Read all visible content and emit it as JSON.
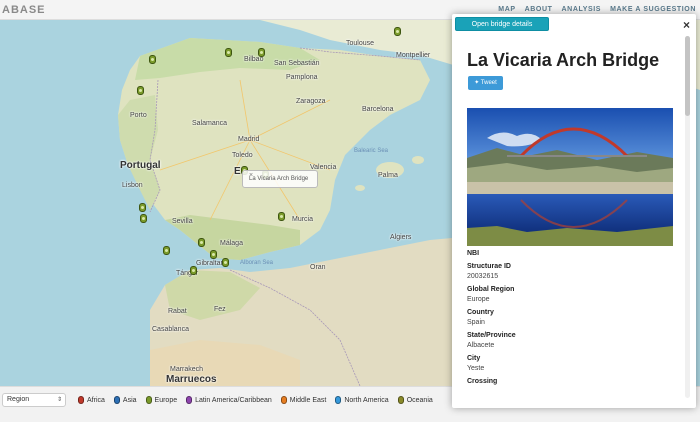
{
  "topbar": {
    "brand": "ABASE",
    "nav": [
      "MAP",
      "ABOUT",
      "ANALYSIS",
      "MAKE A SUGGESTION"
    ]
  },
  "map": {
    "countries": {
      "portugal": "Portugal",
      "spain_partial": "E"
    },
    "cities": {
      "toulouse": "Toulouse",
      "bilbao": "Bilbao",
      "sansebastian": "San Sebastián",
      "montpellier": "Montpellier",
      "pamplona": "Pamplona",
      "porto": "Porto",
      "zaragoza": "Zaragoza",
      "barcelona": "Barcelona",
      "salamanca": "Salamanca",
      "madrid": "Madrid",
      "toledo": "Toledo",
      "valencia": "Valencia",
      "palma": "Palma",
      "lisbon": "Lisbon",
      "sevilla": "Sevilla",
      "murcia": "Murcia",
      "malaga": "Málaga",
      "gibraltar": "Gibraltar",
      "tanger": "Tánger",
      "algiers": "Algiers",
      "oran": "Oran",
      "fez": "Fez",
      "rabat": "Rabat",
      "casablanca": "Casablanca",
      "marrakech": "Marrakech",
      "marruecos": "Marruecos"
    },
    "seas": {
      "alboran": "Alboran Sea",
      "balearic": "Balearic Sea"
    },
    "tooltip": {
      "label": "La Vicaria Arch Bridge",
      "close": "×"
    }
  },
  "legend": {
    "select_value": "Region",
    "items": [
      {
        "label": "Africa",
        "color": "#c0392b"
      },
      {
        "label": "Asia",
        "color": "#2c6fb5"
      },
      {
        "label": "Europe",
        "color": "#7a9a2a"
      },
      {
        "label": "Latin America/Caribbean",
        "color": "#8e44ad"
      },
      {
        "label": "Middle East",
        "color": "#e67e22"
      },
      {
        "label": "North America",
        "color": "#3498db"
      },
      {
        "label": "Oceania",
        "color": "#8a8a2a"
      }
    ]
  },
  "panel": {
    "open_button": "Open bridge details",
    "close": "×",
    "title": "La Vicaria Arch Bridge",
    "tweet": "Tweet",
    "fields": [
      {
        "label": "NBI",
        "value": ""
      },
      {
        "label": "Structurae ID",
        "value": "20032615"
      },
      {
        "label": "Global Region",
        "value": "Europe"
      },
      {
        "label": "Country",
        "value": "Spain"
      },
      {
        "label": "State/Province",
        "value": "Albacete"
      },
      {
        "label": "City",
        "value": "Yeste"
      },
      {
        "label": "Crossing",
        "value": ""
      }
    ]
  }
}
